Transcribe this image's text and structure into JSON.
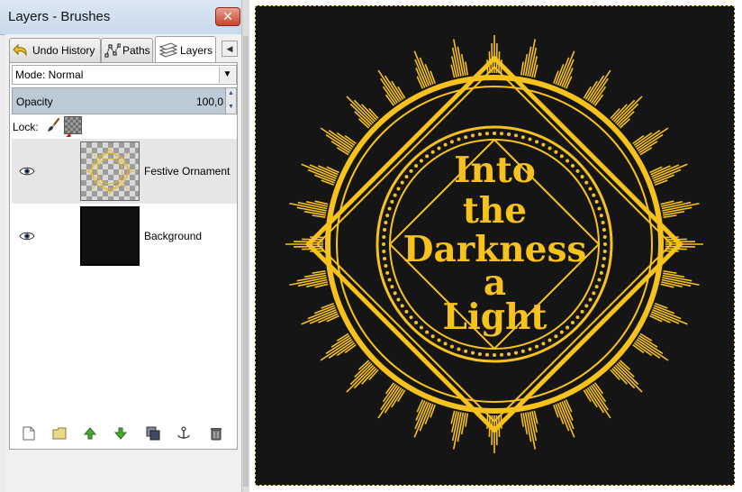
{
  "window": {
    "title": "Layers - Brushes",
    "close_symbol": "✕"
  },
  "tabs": [
    {
      "label": "Undo History",
      "icon": "undo-icon",
      "active": false
    },
    {
      "label": "Paths",
      "icon": "paths-icon",
      "active": false
    },
    {
      "label": "Layers",
      "icon": "layers-icon",
      "active": true
    }
  ],
  "tab_menu_symbol": "◀",
  "mode": {
    "label": "Mode: Normal",
    "arrow": "▼"
  },
  "opacity": {
    "label": "Opacity",
    "value": "100,0"
  },
  "lock": {
    "label": "Lock:",
    "icons": [
      "paintbrush-icon",
      "alpha-lock-icon"
    ]
  },
  "layers": [
    {
      "name": "Festive Ornament",
      "visible": true,
      "selected": true
    },
    {
      "name": "Background",
      "visible": true,
      "selected": false
    }
  ],
  "toolbar": {
    "buttons": [
      "new-layer-icon",
      "new-group-icon",
      "raise-layer-icon",
      "lower-layer-icon",
      "duplicate-layer-icon",
      "anchor-layer-icon",
      "delete-layer-icon"
    ]
  },
  "canvas": {
    "text_lines": [
      "Into",
      "the",
      "Darkness",
      "a",
      "Light"
    ],
    "colors": {
      "ornament": "#f7c21b",
      "background": "#151515"
    }
  }
}
